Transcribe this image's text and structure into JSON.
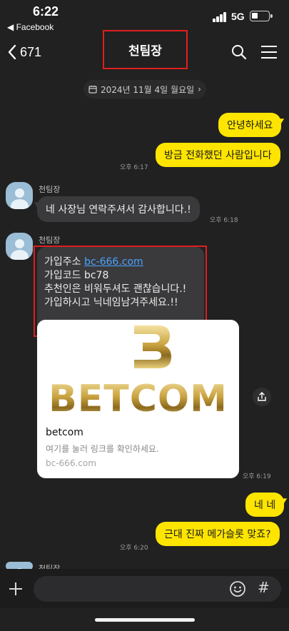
{
  "status_bar": {
    "time": "6:22",
    "back_app": "◀ Facebook",
    "network": "5G"
  },
  "nav": {
    "back_count": "671",
    "title": "천팀장",
    "icons": [
      "search-icon",
      "menu-icon"
    ]
  },
  "date_chip": {
    "text": "2024년 11월 4일 월요일",
    "icons": [
      "calendar-icon",
      "chevron-right-icon"
    ]
  },
  "messages": {
    "me1": {
      "text": "안녕하세요"
    },
    "me2": {
      "text": "방금 전화했던 사람입니다",
      "time": "오후 6:17"
    },
    "sender1": "천팀장",
    "other1": {
      "text": "네 사장님 연락주셔서 감사합니다.!",
      "time": "오후 6:18"
    },
    "sender2": "천팀장",
    "other2": {
      "line1_prefix": "가입주소 ",
      "line1_link": "bc-666.com",
      "line2": "가입코드 bc78",
      "line3": "추천인은 비워두셔도 괜찮습니다.!",
      "line4": "가입하시고 닉네임남겨주세요.!!"
    },
    "link_card": {
      "logo_text": "BETCOM",
      "title": "betcom",
      "description": "여기를 눌러 링크를 확인하세요.",
      "url": "bc-666.com",
      "time": "오후 6:19"
    },
    "me3": {
      "text": "네 네"
    },
    "me4": {
      "text": "근대 진짜 메가슬롯 맞죠?",
      "time": "오후 6:20"
    },
    "sender3": "천팀장"
  },
  "input_bar": {
    "icons": [
      "plus-icon",
      "emoji-icon",
      "hash-icon"
    ],
    "hash_label": "#"
  },
  "colors": {
    "background": "#212121",
    "my_bubble": "#fee500",
    "other_bubble": "#3a3a3c",
    "highlight": "#e01e1e",
    "link": "#4aa3ff"
  }
}
